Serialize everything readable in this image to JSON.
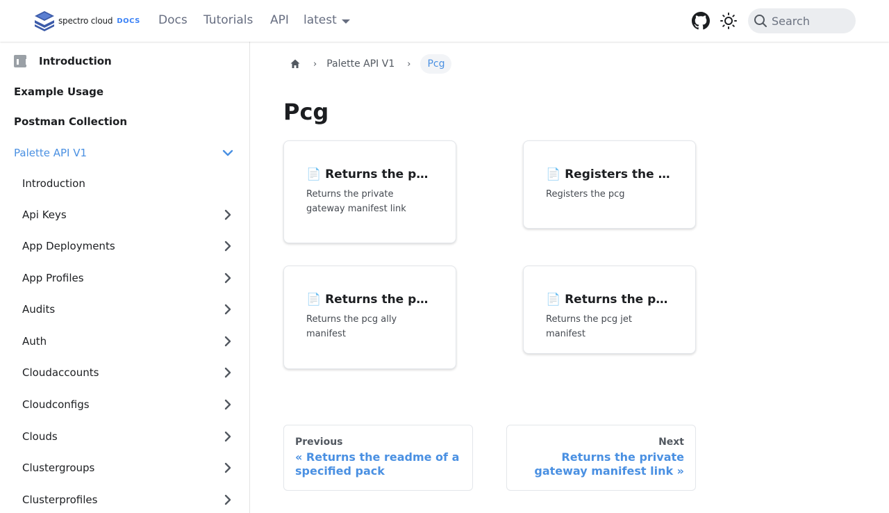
{
  "navbar": {
    "logo_text": "spectro cloud",
    "logo_docs": "DOCS",
    "links": [
      "Docs",
      "Tutorials",
      "API"
    ],
    "version": "latest",
    "search_placeholder": "Search"
  },
  "sidebar": {
    "top_items": [
      {
        "label": "Introduction"
      },
      {
        "label": "Example Usage"
      },
      {
        "label": "Postman Collection"
      }
    ],
    "active_section": "Palette API V1",
    "sub_items": [
      {
        "label": "Introduction"
      },
      {
        "label": "Api Keys"
      },
      {
        "label": "App Deployments"
      },
      {
        "label": "App Profiles"
      },
      {
        "label": "Audits"
      },
      {
        "label": "Auth"
      },
      {
        "label": "Cloudaccounts"
      },
      {
        "label": "Cloudconfigs"
      },
      {
        "label": "Clouds"
      },
      {
        "label": "Clustergroups"
      },
      {
        "label": "Clusterprofiles"
      }
    ]
  },
  "breadcrumbs": {
    "items": [
      "Palette API V1"
    ],
    "current": "Pcg"
  },
  "page": {
    "title": "Pcg",
    "cards": [
      {
        "title": "📄 Returns the private gateway manifest link",
        "desc": "Returns the private gateway manifest link"
      },
      {
        "title": "📄 Registers the pcg",
        "desc": "Registers the pcg"
      },
      {
        "title": "📄 Returns the pcg ally manifest",
        "desc": "Returns the pcg ally manifest"
      },
      {
        "title": "📄 Returns the pcg jet manifest",
        "desc": "Returns the pcg jet manifest"
      }
    ],
    "pager": {
      "prev_label": "Previous",
      "prev_link": "« Returns the readme of a specified pack",
      "next_label": "Next",
      "next_link": "Returns the private gateway manifest link »"
    }
  },
  "colors": {
    "accent": "#4a90e2",
    "text": "#1c1e21"
  },
  "icons": [
    "spectro-cloud-logo-icon",
    "caret-down-icon",
    "github-icon",
    "theme-toggle-icon",
    "search-icon",
    "home-icon",
    "chevron-right-icon",
    "chevron-down-icon"
  ]
}
